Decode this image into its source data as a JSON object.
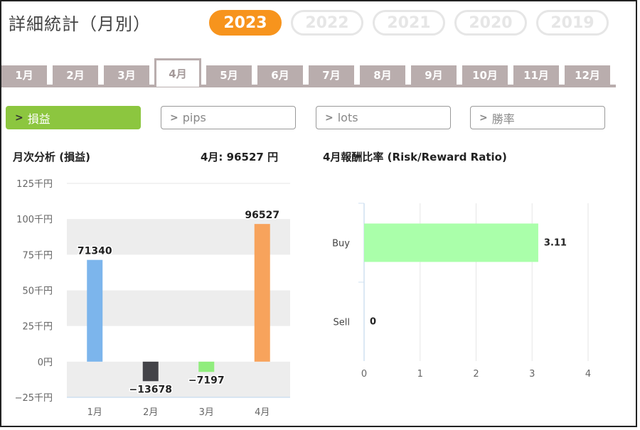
{
  "page_title": "詳細統計（月別）",
  "years": [
    "2023",
    "2022",
    "2021",
    "2020",
    "2019"
  ],
  "selected_year": "2023",
  "months": [
    "1月",
    "2月",
    "3月",
    "4月",
    "5月",
    "6月",
    "7月",
    "8月",
    "9月",
    "10月",
    "11月",
    "12月"
  ],
  "selected_month": "4月",
  "metrics": [
    {
      "label": "損益",
      "active": true
    },
    {
      "label": "pips",
      "active": false
    },
    {
      "label": "lots",
      "active": false
    },
    {
      "label": "勝率",
      "active": false
    }
  ],
  "left_title": "月次分析 (損益)",
  "left_summary": "4月:  96527 円",
  "right_title": "4月報酬比率 (Risk/Reward Ratio)",
  "colors": {
    "accent": "#f7941d",
    "active_metric": "#8cc63f",
    "tab": "#b9adad"
  },
  "chart_data": [
    {
      "type": "bar",
      "categories": [
        "1月",
        "2月",
        "3月",
        "4月"
      ],
      "values": [
        71340,
        -13678,
        -7197,
        96527
      ],
      "value_labels": [
        "71340",
        "−13678",
        "−7197",
        "96527"
      ],
      "bar_colors": [
        "#7cb5ec",
        "#434348",
        "#90ed7d",
        "#f7a35c"
      ],
      "ylim": [
        -25000,
        125000
      ],
      "yticks": [
        -25000,
        0,
        25000,
        50000,
        75000,
        100000,
        125000
      ],
      "ytick_labels": [
        "−25千円",
        "0円",
        "25千円",
        "50千円",
        "75千円",
        "100千円",
        "125千円"
      ],
      "grid": "alternating bands"
    },
    {
      "type": "bar",
      "orientation": "horizontal",
      "categories": [
        "Buy",
        "Sell"
      ],
      "values": [
        3.11,
        0
      ],
      "value_labels": [
        "3.11",
        "0"
      ],
      "bar_color": "#aaffaa",
      "xlim": [
        0,
        4
      ],
      "xticks": [
        0,
        1,
        2,
        3,
        4
      ],
      "grid": true
    }
  ]
}
